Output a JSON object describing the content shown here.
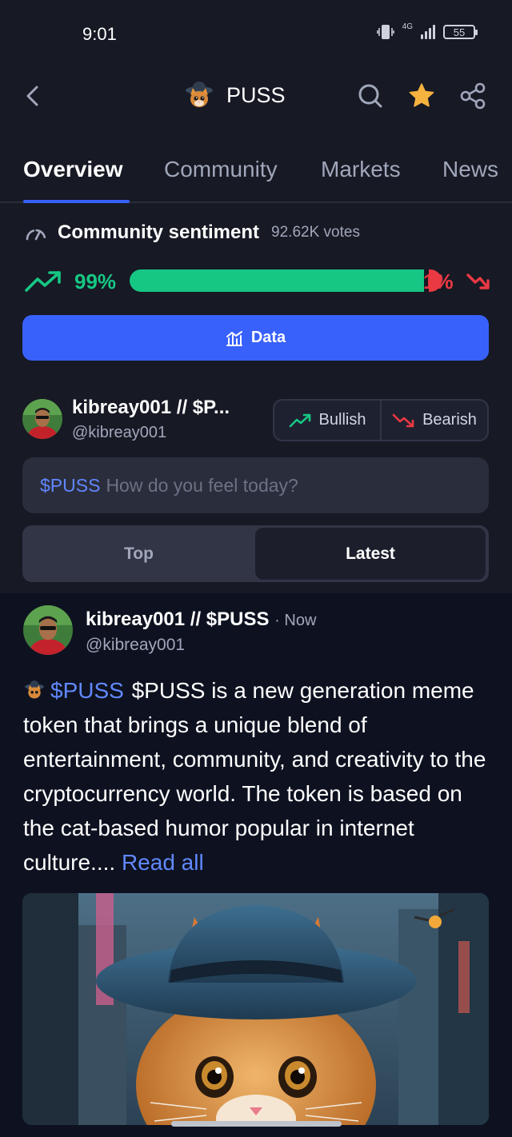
{
  "status_bar": {
    "time": "9:01",
    "network": "4G",
    "battery": "55"
  },
  "header": {
    "title": "PUSS",
    "back_icon": "chevron-left-icon",
    "search_icon": "search-icon",
    "star_icon": "star-icon",
    "share_icon": "share-icon"
  },
  "tabs": [
    {
      "label": "Overview",
      "active": true
    },
    {
      "label": "Community",
      "active": false
    },
    {
      "label": "Markets",
      "active": false
    },
    {
      "label": "News",
      "active": false
    }
  ],
  "sentiment": {
    "title": "Community sentiment",
    "votes": "92.62K votes",
    "bullish_pct": "99%",
    "bearish_pct": "1%",
    "bullish_fraction": 0.99,
    "bullish_color": "#16c784",
    "bearish_color": "#ea3943"
  },
  "data_button": {
    "label": "Data"
  },
  "poster": {
    "name": "kibreay001 // $P...",
    "handle": "@kibreay001"
  },
  "vote_buttons": {
    "bullish": "Bullish",
    "bearish": "Bearish"
  },
  "compose": {
    "tag": "$PUSS",
    "placeholder": "How do you feel today?"
  },
  "sort": {
    "top": "Top",
    "latest": "Latest",
    "selected": "Latest"
  },
  "post": {
    "name": "kibreay001 // $PUSS",
    "time": "· Now",
    "handle": "@kibreay001",
    "tag": "$PUSS",
    "text": "$PUSS is a new generation meme token that brings a unique blend of entertainment, community, and creativity to the cryptocurrency world. The token is based on the cat-based humor popular in internet culture....",
    "read_all": "Read all"
  },
  "colors": {
    "accent": "#3861fb",
    "background": "#171924",
    "feed_background": "#0e1220",
    "link": "#6188ff"
  }
}
